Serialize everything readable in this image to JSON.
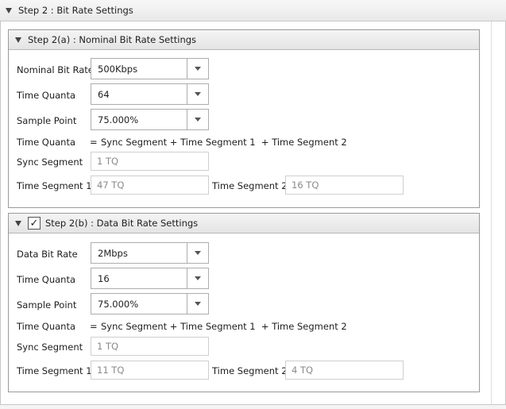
{
  "step2": {
    "title": "Step 2 : Bit Rate Settings"
  },
  "nominal": {
    "title": "Step 2(a) : Nominal Bit Rate Settings",
    "bit_rate_label": "Nominal Bit Rate",
    "bit_rate_value": "500Kbps",
    "time_quanta_label": "Time Quanta",
    "time_quanta_value": "64",
    "sample_point_label": "Sample Point",
    "sample_point_value": "75.000%",
    "formula_label": "Time Quanta",
    "formula_eq": "=",
    "formula_text": "Sync Segment + Time Segment 1  + Time Segment 2",
    "sync_segment_label": "Sync Segment",
    "sync_segment_value": "1 TQ",
    "time_segment1_label": "Time Segment 1",
    "time_segment1_value": "47 TQ",
    "time_segment2_label": "Time Segment 2",
    "time_segment2_value": "16 TQ"
  },
  "data_rate": {
    "title": "Step 2(b) : Data Bit Rate Settings",
    "checked": true,
    "check_glyph": "✓",
    "bit_rate_label": "Data Bit Rate",
    "bit_rate_value": "2Mbps",
    "time_quanta_label": "Time Quanta",
    "time_quanta_value": "16",
    "sample_point_label": "Sample Point",
    "sample_point_value": "75.000%",
    "formula_label": "Time Quanta",
    "formula_eq": "=",
    "formula_text": "Sync Segment + Time Segment 1  + Time Segment 2",
    "sync_segment_label": "Sync Segment",
    "sync_segment_value": "1 TQ",
    "time_segment1_label": "Time Segment 1",
    "time_segment1_value": "11 TQ",
    "time_segment2_label": "Time Segment 2",
    "time_segment2_value": "4 TQ"
  },
  "icons": {
    "collapse": "collapse-triangle-icon",
    "dropdown": "chevron-down-icon",
    "check": "checkmark-icon"
  }
}
